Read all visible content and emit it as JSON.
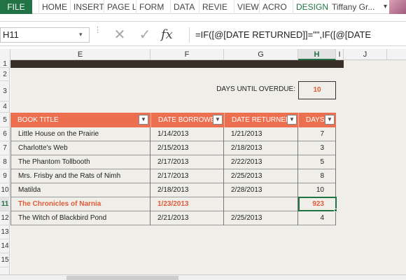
{
  "ribbon": {
    "file_tab": "FILE",
    "tabs": [
      "HOME",
      "INSERT",
      "PAGE L",
      "FORM",
      "DATA",
      "REVIE",
      "VIEW",
      "ACRO",
      "DESIGN"
    ],
    "user_name": "Tiffany Gr...",
    "user_caret": "▾"
  },
  "formula_bar": {
    "name_box": "H11",
    "name_box_caret": "▾",
    "cancel_icon": "✕",
    "enter_icon": "✓",
    "fx_label": "fx",
    "formula": "=IF([@[DATE RETURNED]]=\"\",IF([@[DATE"
  },
  "grid": {
    "columns": [
      "E",
      "F",
      "G",
      "H",
      "I",
      "J"
    ],
    "rows": [
      "1",
      "2",
      "3",
      "4",
      "5",
      "6",
      "7",
      "8",
      "9",
      "10",
      "11",
      "12",
      "13",
      "14",
      "15"
    ],
    "active_column": "H",
    "active_row": "11"
  },
  "overdue": {
    "label": "DAYS UNTIL OVERDUE:",
    "value": "10"
  },
  "table": {
    "headers": [
      "BOOK TITLE",
      "DATE BORROWE",
      "DATE RETURNED",
      "DAYS"
    ],
    "rows": [
      {
        "title": "Little House on the Prairie",
        "borrowed": "1/14/2013",
        "returned": "1/21/2013",
        "days": "7"
      },
      {
        "title": "Charlotte's Web",
        "borrowed": "2/15/2013",
        "returned": "2/18/2013",
        "days": "3"
      },
      {
        "title": "The Phantom Tollbooth",
        "borrowed": "2/17/2013",
        "returned": "2/22/2013",
        "days": "5"
      },
      {
        "title": "Mrs. Frisby and the Rats of Nimh",
        "borrowed": "2/17/2013",
        "returned": "2/25/2013",
        "days": "8"
      },
      {
        "title": "Matilda",
        "borrowed": "2/18/2013",
        "returned": "2/28/2013",
        "days": "10"
      },
      {
        "title": "The Chronicles of Narnia",
        "borrowed": "1/23/2013",
        "returned": "",
        "days": "923"
      },
      {
        "title": "The Witch of Blackbird Pond",
        "borrowed": "2/21/2013",
        "returned": "2/25/2013",
        "days": "4"
      }
    ],
    "highlight_row": 5,
    "highlight_color": "#e05a3a",
    "header_color": "#ec6f4f"
  },
  "colors": {
    "excel_green": "#217346",
    "sheet_background": "#efeee9",
    "banner_dark": "#3a2e29"
  }
}
